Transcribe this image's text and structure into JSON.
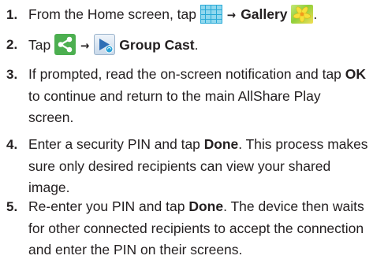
{
  "steps": [
    {
      "number": "1.",
      "before_icon1": "From the Home screen, tap ",
      "icon1": "apps-grid-icon",
      "arrow": "→",
      "bold": "Gallery",
      "icon2": "gallery-icon",
      "after": "."
    },
    {
      "number": "2.",
      "before_icon1": "Tap ",
      "icon1": "share-icon",
      "arrow": "→",
      "icon2": "group-cast-icon",
      "bold": "Group Cast",
      "after": "."
    },
    {
      "number": "3.",
      "line1_a": "If prompted, read the on-screen notification and tap ",
      "line1_bold": "OK",
      "line2": "to continue and return to the main AllShare Play",
      "line3": "screen."
    },
    {
      "number": "4.",
      "line1_a": "Enter a security PIN and tap ",
      "line1_bold": "Done",
      "line1_b": ". This process makes",
      "line2": "sure only desired recipients can view your shared",
      "line3": "image."
    },
    {
      "number": "5.",
      "line1_a": "Re-enter you PIN and tap ",
      "line1_bold": "Done",
      "line1_b": ". The device then waits",
      "line2": "for other connected recipients to accept the connection",
      "line3": "and enter the PIN on their screens."
    }
  ],
  "colors": {
    "text": "#231f20",
    "grid_icon": "#8fd8ee",
    "share_icon": "#4caf50"
  }
}
